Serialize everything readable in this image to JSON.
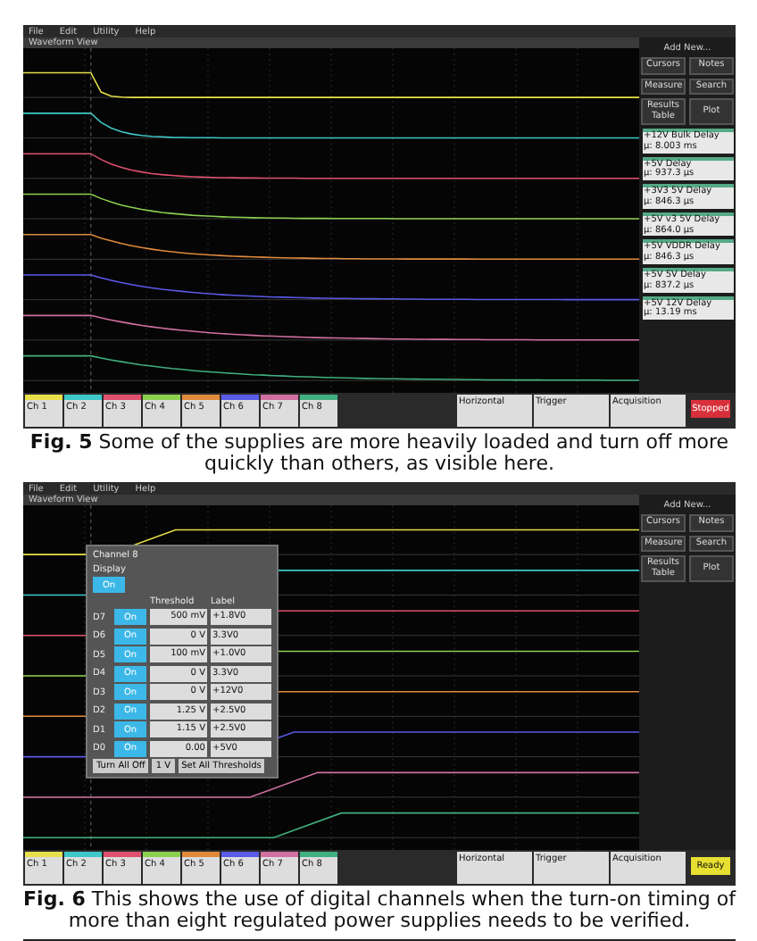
{
  "figures": [
    {
      "menu": [
        "File",
        "Edit",
        "Utility",
        "Help"
      ],
      "view_title": "Waveform View",
      "plot": {
        "kind": "turn-off"
      },
      "side": {
        "header": "Add New...",
        "buttons": [
          "Cursors",
          "Notes",
          "Measure",
          "Search",
          "Results Table",
          "Plot"
        ],
        "results": [
          {
            "title": "+12V Bulk Delay",
            "value": "μ: 8.003 ms"
          },
          {
            "title": "+5V Delay",
            "value": "μ: 937.3 μs"
          },
          {
            "title": "+3V3 5V Delay",
            "value": "μ: 846.3 μs"
          },
          {
            "title": "+5V v3 5V Delay",
            "value": "μ: 864.0 μs"
          },
          {
            "title": "+5V VDDR Delay",
            "value": "μ: 846.3 μs"
          },
          {
            "title": "+5V 5V Delay",
            "value": "μ: 837.2 μs"
          },
          {
            "title": "+5V 12V Delay",
            "value": "μ: 13.19 ms"
          }
        ]
      },
      "channels": [
        {
          "label": "Ch 1",
          "color": "#e8e04a"
        },
        {
          "label": "Ch 2",
          "color": "#3ec8c8"
        },
        {
          "label": "Ch 3",
          "color": "#e0506e"
        },
        {
          "label": "Ch 4",
          "color": "#8cd050"
        },
        {
          "label": "Ch 5",
          "color": "#e08a3c"
        },
        {
          "label": "Ch 6",
          "color": "#5a5ae8"
        },
        {
          "label": "Ch 7",
          "color": "#d070a0"
        },
        {
          "label": "Ch 8",
          "color": "#40b080"
        }
      ],
      "status": [
        "Horizontal",
        "Trigger",
        "Acquisition"
      ],
      "run_button": {
        "label": "Stopped",
        "kind": "stopped"
      },
      "caption": {
        "number": "Fig. 5",
        "text": "Some of the supplies are more heavily loaded and turn off more quickly than others, as visible here."
      }
    },
    {
      "menu": [
        "File",
        "Edit",
        "Utility",
        "Help"
      ],
      "view_title": "Waveform View",
      "plot": {
        "kind": "turn-on"
      },
      "side": {
        "header": "Add New...",
        "buttons": [
          "Cursors",
          "Notes",
          "Measure",
          "Search",
          "Results Table",
          "Plot"
        ]
      },
      "channels": [
        {
          "label": "Ch 1",
          "color": "#e8e04a"
        },
        {
          "label": "Ch 2",
          "color": "#3ec8c8"
        },
        {
          "label": "Ch 3",
          "color": "#e0506e"
        },
        {
          "label": "Ch 4",
          "color": "#8cd050"
        },
        {
          "label": "Ch 5",
          "color": "#e08a3c"
        },
        {
          "label": "Ch 6",
          "color": "#5a5ae8"
        },
        {
          "label": "Ch 7",
          "color": "#d070a0"
        },
        {
          "label": "Ch 8",
          "color": "#40b080"
        }
      ],
      "dialog": {
        "title": "Channel 8",
        "display_label": "Display",
        "display_value": "On",
        "columns": [
          "Threshold",
          "Label"
        ],
        "rows": [
          {
            "name": "D7",
            "state": "On",
            "threshold": "500 mV",
            "label": "+1.8V0"
          },
          {
            "name": "D6",
            "state": "On",
            "threshold": "0 V",
            "label": "3.3V0"
          },
          {
            "name": "D5",
            "state": "On",
            "threshold": "100 mV",
            "label": "+1.0V0"
          },
          {
            "name": "D4",
            "state": "On",
            "threshold": "0 V",
            "label": "3.3V0"
          },
          {
            "name": "D3",
            "state": "On",
            "threshold": "0 V",
            "label": "+12V0"
          },
          {
            "name": "D2",
            "state": "On",
            "threshold": "1.25 V",
            "label": "+2.5V0"
          },
          {
            "name": "D1",
            "state": "On",
            "threshold": "1.15 V",
            "label": "+2.5V0"
          },
          {
            "name": "D0",
            "state": "On",
            "threshold": "0.00",
            "label": "+5V0"
          }
        ],
        "footer": [
          "Turn All Off",
          "1 V",
          "Set All Thresholds"
        ]
      },
      "status": [
        "Horizontal",
        "Trigger",
        "Acquisition"
      ],
      "run_button": {
        "label": "Ready",
        "kind": "ready"
      },
      "caption": {
        "number": "Fig. 6",
        "text": "This shows the use of digital channels when the turn-on timing of more than eight regulated power supplies needs to be verified."
      }
    }
  ]
}
